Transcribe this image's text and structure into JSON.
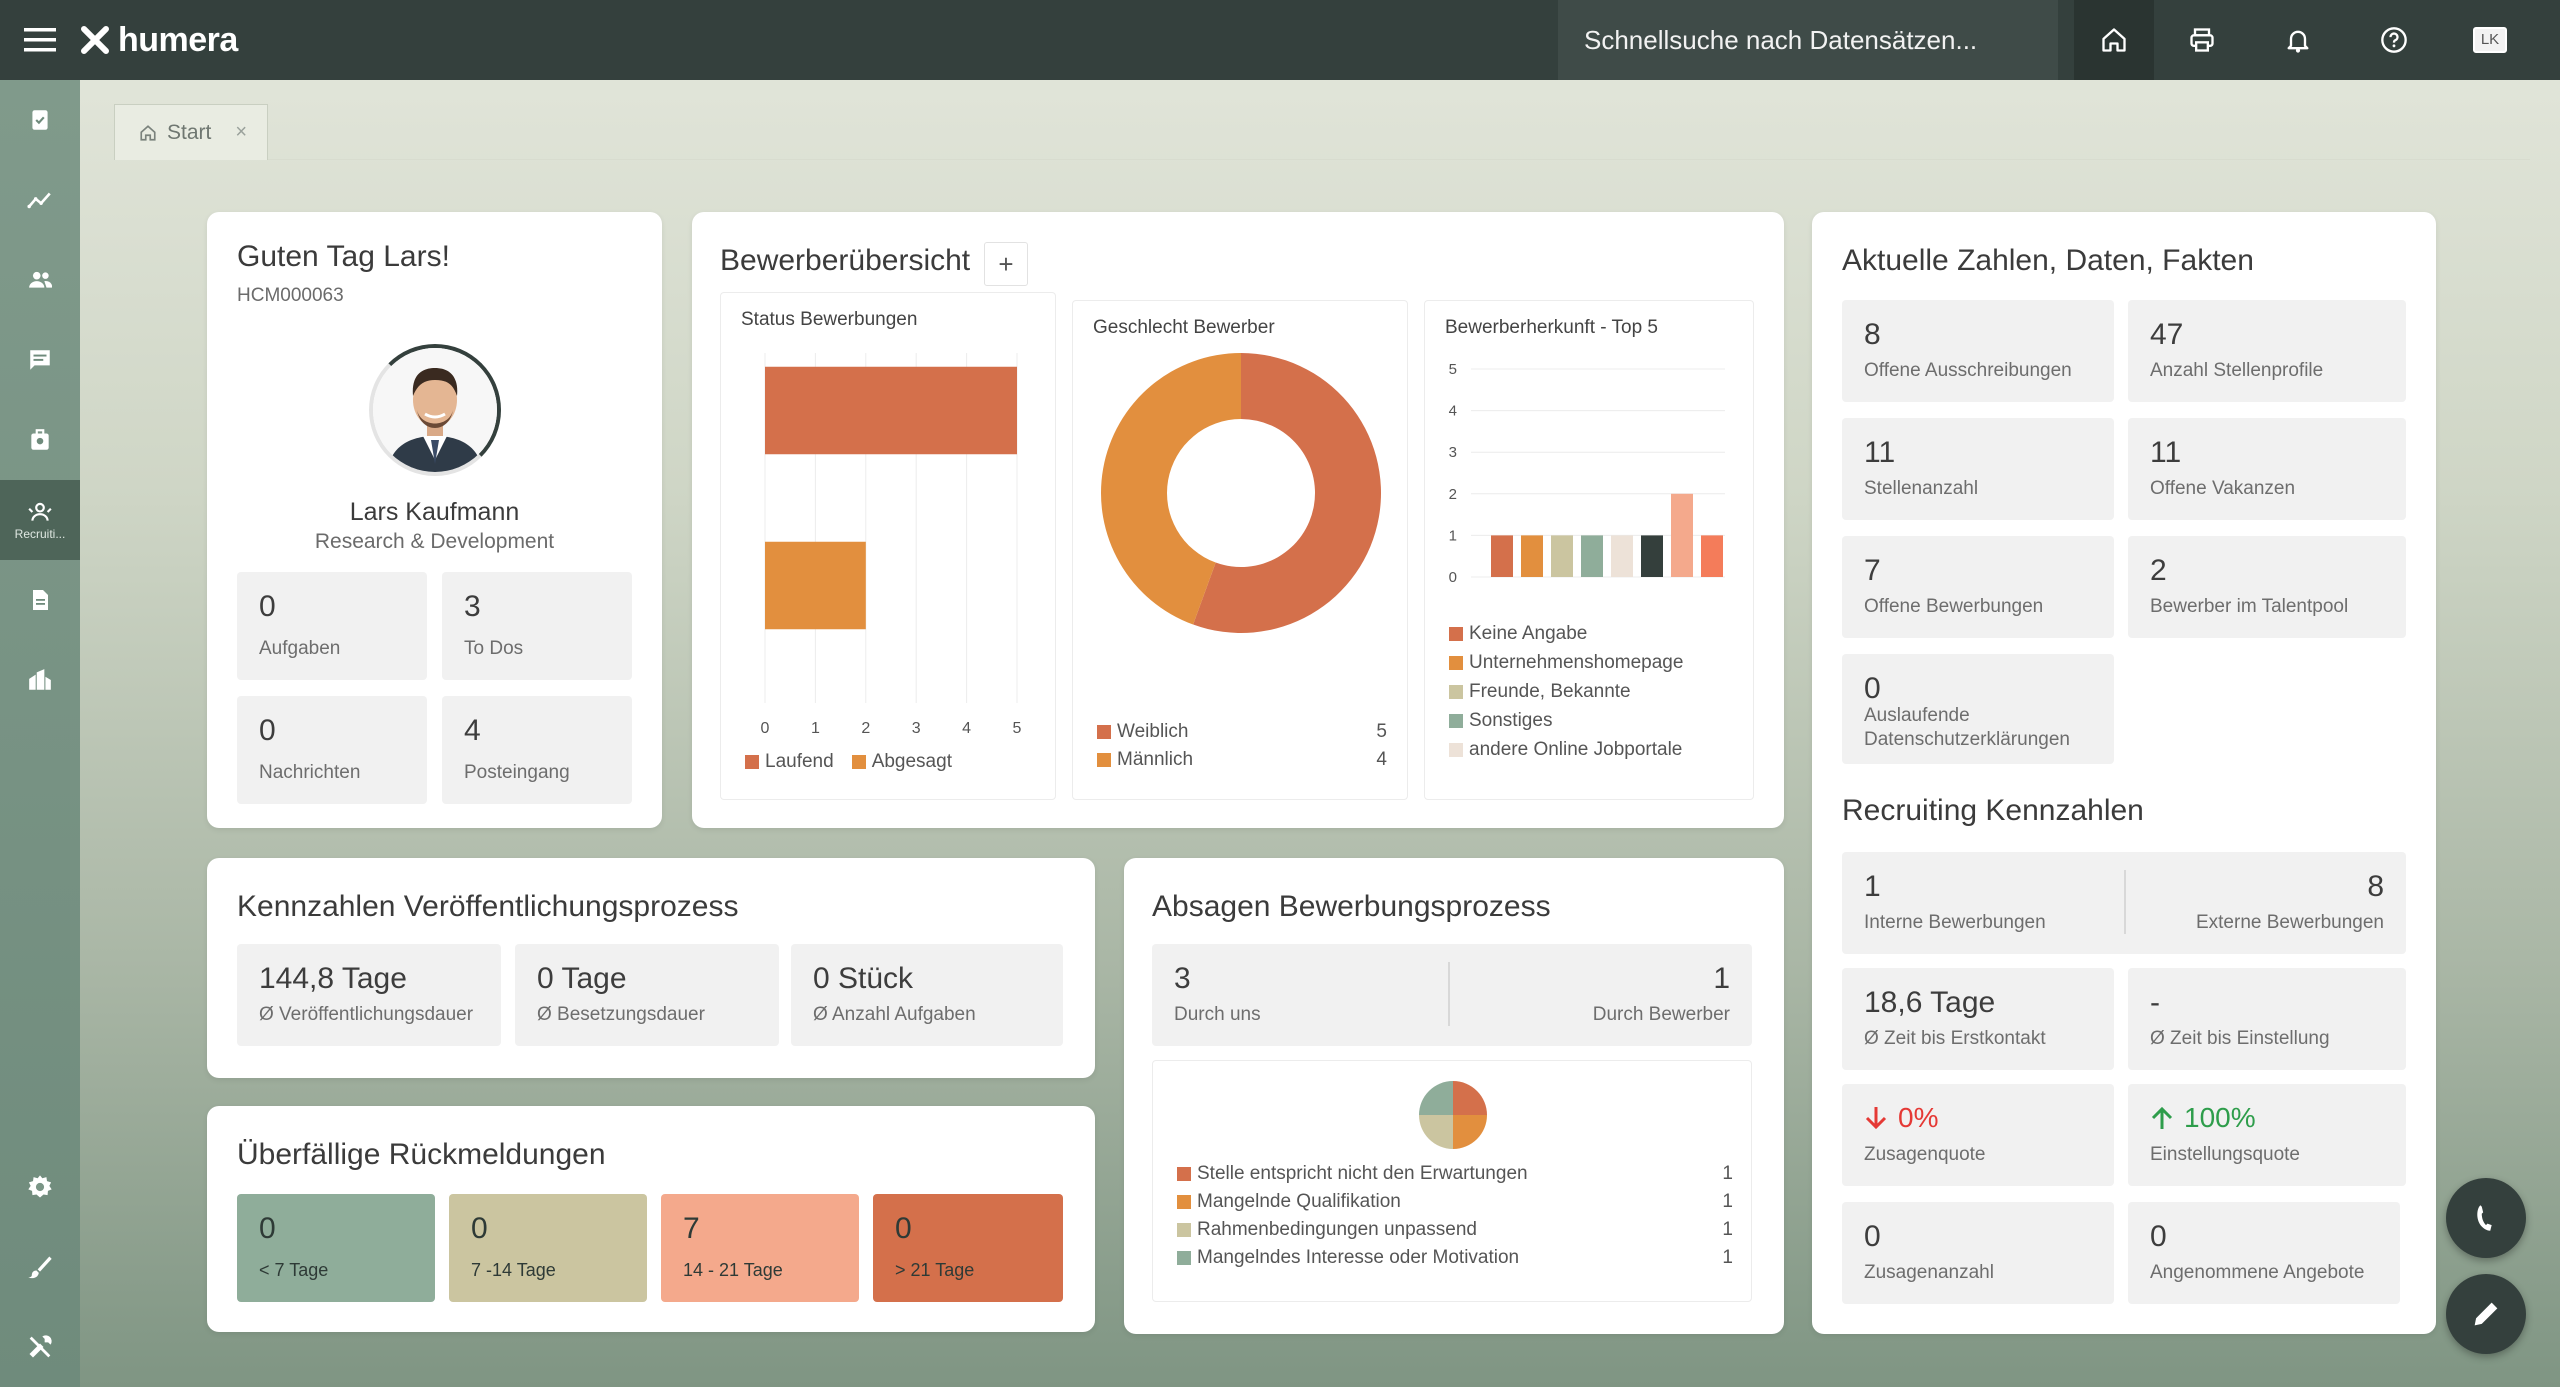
{
  "topbar": {
    "logo": "humera",
    "search_placeholder": "Schnellsuche nach Datensätzen...",
    "icons": [
      "home-icon",
      "print-icon",
      "bell-icon",
      "help-icon"
    ],
    "user_initials": "LK"
  },
  "sidebar": {
    "items": [
      {
        "icon": "clipboard-check-icon"
      },
      {
        "icon": "analytics-icon"
      },
      {
        "icon": "people-icon"
      },
      {
        "icon": "chat-icon"
      },
      {
        "icon": "briefcase-icon"
      },
      {
        "icon": "recruiting-icon",
        "label": "Recruiti...",
        "active": true
      },
      {
        "icon": "document-icon"
      },
      {
        "icon": "building-icon"
      }
    ],
    "bottom_items": [
      {
        "icon": "gear-icon"
      },
      {
        "icon": "brush-icon"
      },
      {
        "icon": "tools-icon"
      }
    ]
  },
  "tabs": [
    {
      "label": "Start"
    }
  ],
  "welcome": {
    "greeting": "Guten Tag Lars!",
    "employee_id": "HCM000063",
    "name": "Lars Kaufmann",
    "department": "Research & Development",
    "tiles": [
      {
        "value": "0",
        "label": "Aufgaben"
      },
      {
        "value": "3",
        "label": "To Dos"
      },
      {
        "value": "0",
        "label": "Nachrichten"
      },
      {
        "value": "4",
        "label": "Posteingang"
      }
    ]
  },
  "applicants": {
    "title": "Bewerberübersicht",
    "add_label": "+"
  },
  "chart_data": [
    {
      "type": "bar",
      "orientation": "horizontal",
      "title": "Status Bewerbungen",
      "categories": [
        "Laufend",
        "Abgesagt"
      ],
      "values": [
        5,
        2
      ],
      "xlim": [
        0,
        5
      ],
      "ticks": [
        "0",
        "1",
        "2",
        "3",
        "4",
        "5"
      ],
      "colors": [
        "#d4704b",
        "#e28f3e"
      ],
      "legend": [
        "Laufend",
        "Abgesagt"
      ],
      "legend_position": "bottom"
    },
    {
      "type": "pie",
      "donut": true,
      "title": "Geschlecht Bewerber",
      "labels": [
        "Weiblich",
        "Männlich"
      ],
      "values": [
        5,
        4
      ],
      "colors": [
        "#d4704b",
        "#e28f3e"
      ],
      "legend_position": "bottom"
    },
    {
      "type": "bar",
      "title": "Bewerberherkunft - Top 5",
      "values": [
        1,
        1,
        1,
        1,
        1,
        1,
        2,
        1
      ],
      "ylim": [
        0,
        5
      ],
      "ticks": [
        "0",
        "1",
        "2",
        "3",
        "4",
        "5"
      ],
      "colors": [
        "#d4704b",
        "#e28f3e",
        "#cbc5a0",
        "#8fad9a",
        "#ede2d8",
        "#343f3c",
        "#f4a98c",
        "#f47c5a"
      ],
      "legend": [
        "Keine Angabe",
        "Unternehmenshomepage",
        "Freunde, Bekannte",
        "Sonstiges",
        "andere Online Jobportale"
      ],
      "legend_colors": [
        "#d4704b",
        "#e28f3e",
        "#cbc5a0",
        "#8fad9a",
        "#ede2d8"
      ],
      "legend_position": "bottom"
    },
    {
      "type": "pie",
      "title": "",
      "labels": [
        "Stelle entspricht nicht den Erwartungen",
        "Mangelnde Qualifikation",
        "Rahmenbedingungen unpassend",
        "Mangelndes Interesse oder Motivation"
      ],
      "values": [
        1,
        1,
        1,
        1
      ],
      "colors": [
        "#d4704b",
        "#e28f3e",
        "#cbc5a0",
        "#8fad9a"
      ],
      "legend_position": "bottom"
    }
  ],
  "gender_counts": [
    "5",
    "4"
  ],
  "facts": {
    "title": "Aktuelle Zahlen, Daten, Fakten",
    "tiles": [
      {
        "value": "8",
        "label": "Offene Ausschreibungen"
      },
      {
        "value": "47",
        "label": "Anzahl Stellenprofile"
      },
      {
        "value": "11",
        "label": "Stellenanzahl"
      },
      {
        "value": "11",
        "label": "Offene Vakanzen"
      },
      {
        "value": "7",
        "label": "Offene Bewerbungen"
      },
      {
        "value": "2",
        "label": "Bewerber im Talentpool"
      },
      {
        "value": "0",
        "label": "Auslaufende Datenschutzerklärungen"
      }
    ]
  },
  "recruiting": {
    "title": "Recruiting Kennzahlen",
    "internal": {
      "value": "1",
      "label": "Interne Bewerbungen"
    },
    "external": {
      "value": "8",
      "label": "Externe Bewerbungen"
    },
    "tiles": [
      {
        "value": "18,6 Tage",
        "label": "Ø Zeit bis Erstkontakt"
      },
      {
        "value": "-",
        "label": "Ø Zeit bis Einstellung"
      },
      {
        "value": "0%",
        "label": "Zusagenquote",
        "trend": "down",
        "color": "#e53935"
      },
      {
        "value": "100%",
        "label": "Einstellungsquote",
        "trend": "up",
        "color": "#2e9d4b"
      },
      {
        "value": "0",
        "label": "Zusagenanzahl"
      },
      {
        "value": "0",
        "label": "Angenommene Angebote"
      }
    ]
  },
  "publishing": {
    "title": "Kennzahlen Veröffentlichungsprozess",
    "tiles": [
      {
        "value": "144,8 Tage",
        "label": "Ø Veröffentlichungsdauer"
      },
      {
        "value": "0 Tage",
        "label": "Ø Besetzungsdauer"
      },
      {
        "value": "0 Stück",
        "label": "Ø Anzahl Aufgaben"
      }
    ]
  },
  "rejections": {
    "title": "Absagen Bewerbungsprozess",
    "by_us": {
      "value": "3",
      "label": "Durch uns"
    },
    "by_applicant": {
      "value": "1",
      "label": "Durch Bewerber"
    },
    "reason_counts": [
      "1",
      "1",
      "1",
      "1"
    ]
  },
  "overdue": {
    "title": "Überfällige Rückmeldungen",
    "tiles": [
      {
        "value": "0",
        "label": "< 7 Tage",
        "color": "#8fad9a"
      },
      {
        "value": "0",
        "label": "7 -14 Tage",
        "color": "#cbc5a0"
      },
      {
        "value": "7",
        "label": "14 - 21 Tage",
        "color": "#f4a98c"
      },
      {
        "value": "0",
        "label": "> 21 Tage",
        "color": "#d4704b"
      }
    ]
  },
  "fabs": [
    "phone-icon",
    "edit-icon"
  ]
}
